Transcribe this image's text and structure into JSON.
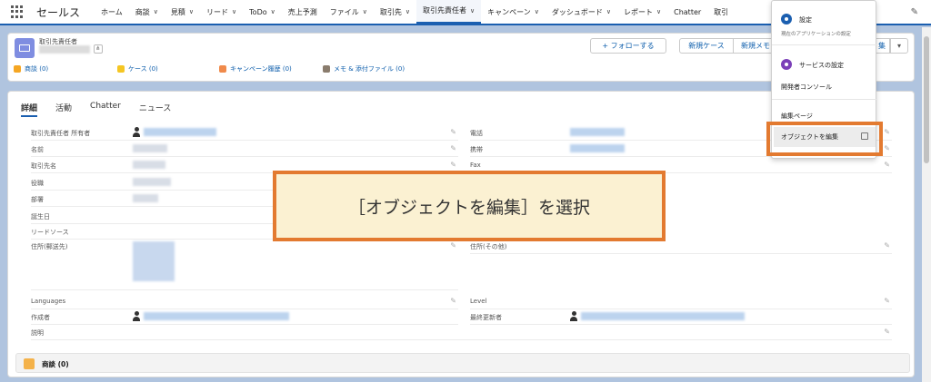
{
  "app": {
    "name": "セールス"
  },
  "nav": [
    {
      "label": "ホーム",
      "chev": false
    },
    {
      "label": "商談",
      "chev": true
    },
    {
      "label": "見積",
      "chev": true
    },
    {
      "label": "リード",
      "chev": true
    },
    {
      "label": "ToDo",
      "chev": true
    },
    {
      "label": "売上予測",
      "chev": false
    },
    {
      "label": "ファイル",
      "chev": true
    },
    {
      "label": "取引先",
      "chev": true
    },
    {
      "label": "取引先責任者",
      "chev": true,
      "active": true
    },
    {
      "label": "キャンペーン",
      "chev": true
    },
    {
      "label": "ダッシュボード",
      "chev": true
    },
    {
      "label": "レポート",
      "chev": true
    },
    {
      "label": "Chatter",
      "chev": false
    },
    {
      "label": "取引",
      "chev": false
    }
  ],
  "header": {
    "object_label": "取引先責任者",
    "follow_button": "+ フォローする",
    "new_case_button": "新規ケース",
    "new_memo_button": "新規メモ",
    "edit_button": "集",
    "related": [
      {
        "label": "商談 (0)",
        "color": "#f5a623"
      },
      {
        "label": "ケース (0)",
        "color": "#f5c623"
      },
      {
        "label": "キャンペーン履歴 (0)",
        "color": "#f08a4b"
      },
      {
        "label": "メモ & 添付ファイル (0)",
        "color": "#8a7c6d"
      }
    ]
  },
  "tabs": [
    "詳細",
    "活動",
    "Chatter",
    "ニュース"
  ],
  "fields_left": [
    {
      "label": "取引先責任者 所有者"
    },
    {
      "label": "名前"
    },
    {
      "label": "取引先名"
    },
    {
      "label": "役職"
    },
    {
      "label": "部署"
    },
    {
      "label": "誕生日"
    },
    {
      "label": "リードソース"
    },
    {
      "label": "住所(郵送先)"
    }
  ],
  "fields_right": [
    {
      "label": "電話"
    },
    {
      "label": "携帯"
    },
    {
      "label": "Fax"
    },
    {
      "label": "住所(その他)"
    }
  ],
  "fields_bottom": {
    "languages": "Languages",
    "level": "Level",
    "created_by": "作成者",
    "modified_by": "最終更新者",
    "description": "説明"
  },
  "related_card": {
    "title": "商談 (0)"
  },
  "callout": {
    "text": "［オブジェクトを編集］を選択"
  },
  "dropdown": {
    "setup_title": "設定",
    "setup_sub": "現在のアプリケーションの設定",
    "service_setup": "サービスの設定",
    "dev_console": "開発者コンソール",
    "edit_page": "編集ページ",
    "edit_object": "オブジェクトを編集"
  }
}
